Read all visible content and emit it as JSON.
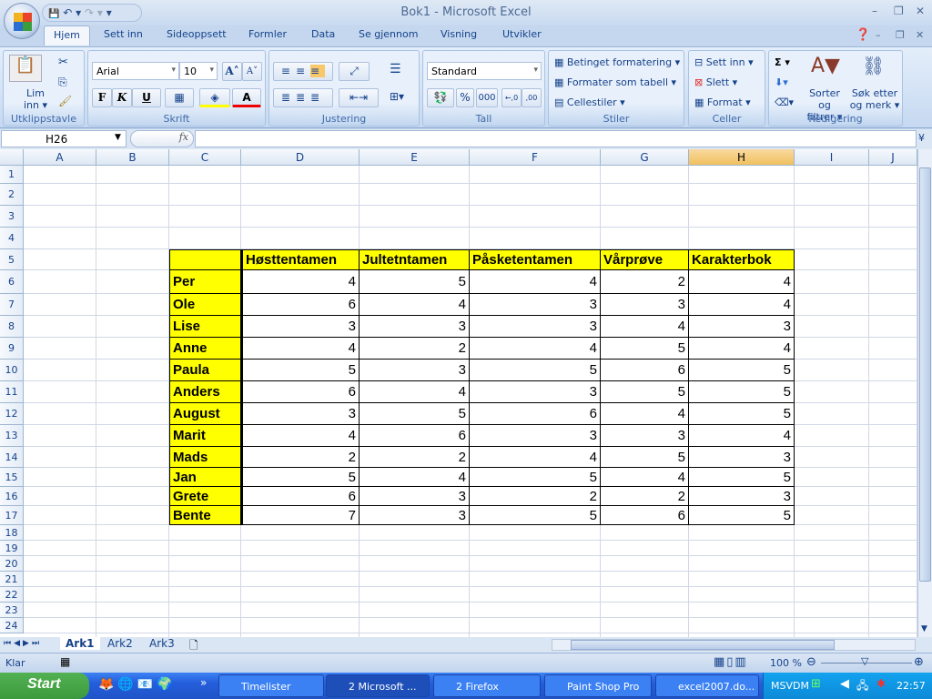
{
  "window": {
    "title": "Bok1 - Microsoft Excel",
    "minimize": "–",
    "restore": "❐",
    "close": "✕"
  },
  "qat": {
    "save": "💾",
    "undo": "↶ ▾",
    "redo": "↷ ▾",
    "more": "▾"
  },
  "tabs": [
    "Hjem",
    "Sett inn",
    "Sideoppsett",
    "Formler",
    "Data",
    "Se gjennom",
    "Visning",
    "Utvikler"
  ],
  "ribbon": {
    "clipboard": {
      "label": "Utklippstavle",
      "paste": "Lim inn ▾"
    },
    "font": {
      "label": "Skrift",
      "name": "Arial",
      "size": "10",
      "grow": "A˄",
      "shrink": "A˅",
      "bold": "F",
      "italic": "K",
      "underline": "U"
    },
    "alignment": {
      "label": "Justering"
    },
    "number": {
      "label": "Tall",
      "format": "Standard",
      "percent": "%",
      "thousands": "000",
      "inc": "←,0",
      "dec": ",00"
    },
    "styles": {
      "label": "Stiler",
      "conditional": "Betinget formatering ▾",
      "table": "Formater som tabell ▾",
      "cell": "Cellestiler ▾"
    },
    "cells": {
      "label": "Celler",
      "insert": "Sett inn ▾",
      "delete": "Slett ▾",
      "format": "Format ▾"
    },
    "editing": {
      "label": "Redigering",
      "sum": "Σ ▾",
      "sort": "Sorter og filtrer ▾",
      "find": "Søk etter og merk ▾"
    }
  },
  "formula_bar": {
    "name_box": "H26",
    "fx": "fx",
    "value": ""
  },
  "columns": [
    "A",
    "B",
    "C",
    "D",
    "E",
    "F",
    "G",
    "H",
    "I",
    "J"
  ],
  "selected_column": "H",
  "rows": [
    "1",
    "2",
    "3",
    "4",
    "5",
    "6",
    "7",
    "8",
    "9",
    "10",
    "11",
    "12",
    "13",
    "14",
    "15",
    "16",
    "17",
    "18",
    "19",
    "20",
    "21",
    "22",
    "23",
    "24"
  ],
  "table": {
    "headers": [
      "Høsttentamen",
      "Jultetntamen",
      "Påsketentamen",
      "Vårprøve",
      "Karakterbok"
    ],
    "students": [
      {
        "name": "Per",
        "values": [
          4,
          5,
          4,
          2,
          4
        ]
      },
      {
        "name": "Ole",
        "values": [
          6,
          4,
          3,
          3,
          4
        ]
      },
      {
        "name": "Lise",
        "values": [
          3,
          3,
          3,
          4,
          3
        ]
      },
      {
        "name": "Anne",
        "values": [
          4,
          2,
          4,
          5,
          4
        ]
      },
      {
        "name": "Paula",
        "values": [
          5,
          3,
          5,
          6,
          5
        ]
      },
      {
        "name": "Anders",
        "values": [
          6,
          4,
          3,
          5,
          5
        ]
      },
      {
        "name": "August",
        "values": [
          3,
          5,
          6,
          4,
          5
        ]
      },
      {
        "name": "Marit",
        "values": [
          4,
          6,
          3,
          3,
          4
        ]
      },
      {
        "name": "Mads",
        "values": [
          2,
          2,
          4,
          5,
          3
        ]
      },
      {
        "name": "Jan",
        "values": [
          5,
          4,
          5,
          4,
          5
        ]
      },
      {
        "name": "Grete",
        "values": [
          6,
          3,
          2,
          2,
          3
        ]
      },
      {
        "name": "Bente",
        "values": [
          7,
          3,
          5,
          6,
          5
        ]
      }
    ],
    "highlight_color": "#ffff00"
  },
  "sheets": [
    "Ark1",
    "Ark2",
    "Ark3"
  ],
  "active_sheet": "Ark1",
  "status": {
    "ready": "Klar",
    "zoom": "100 %"
  },
  "taskbar": {
    "start": "Start",
    "items": [
      "Timelister",
      "2 Microsoft ...",
      "2 Firefox",
      "Paint Shop Pro",
      "excel2007.do..."
    ],
    "active": "2 Microsoft ...",
    "tray_label": "MSVDM",
    "clock": "22:57"
  }
}
